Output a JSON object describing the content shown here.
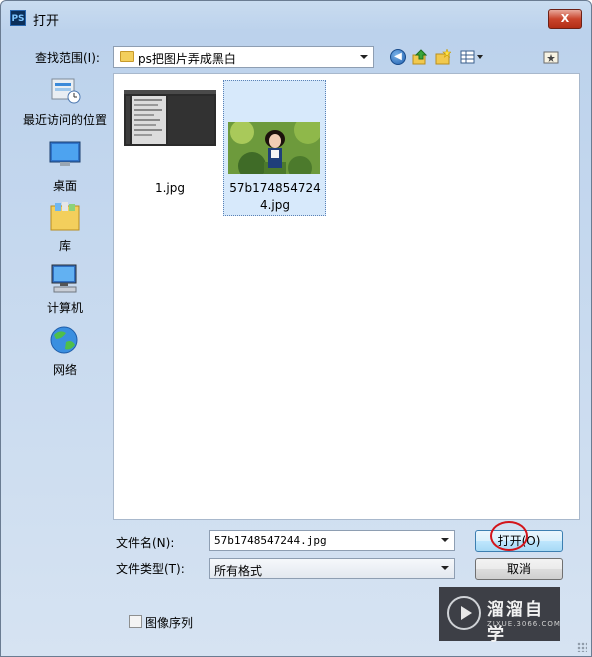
{
  "app_icon": "PS",
  "window": {
    "title": "打开",
    "close_glyph": "X"
  },
  "toolbar": {
    "look_in_label": "查找范围(I):",
    "look_in_value": "ps把图片弄成黑白"
  },
  "places": [
    {
      "label": "最近访问的位置",
      "icon": "recent-places-icon"
    },
    {
      "label": "桌面",
      "icon": "desktop-icon"
    },
    {
      "label": "库",
      "icon": "libraries-icon"
    },
    {
      "label": "计算机",
      "icon": "computer-icon"
    },
    {
      "label": "网络",
      "icon": "network-icon"
    }
  ],
  "files": [
    {
      "name": "1.jpg",
      "selected": false
    },
    {
      "name": "57b1748547244.jpg",
      "selected": true
    }
  ],
  "form": {
    "filename_label": "文件名(N):",
    "filename_value": "57b1748547244.jpg",
    "filetype_label": "文件类型(T):",
    "filetype_value": "所有格式",
    "open_button": "打开(O)",
    "cancel_button": "取消",
    "image_sequence_label": "图像序列"
  },
  "watermark": {
    "title": "溜溜自学",
    "url": "ZIXUE.3066.COM"
  },
  "colors": {
    "selection": "#d7e9fb",
    "annotation_circle": "#d3141a"
  }
}
